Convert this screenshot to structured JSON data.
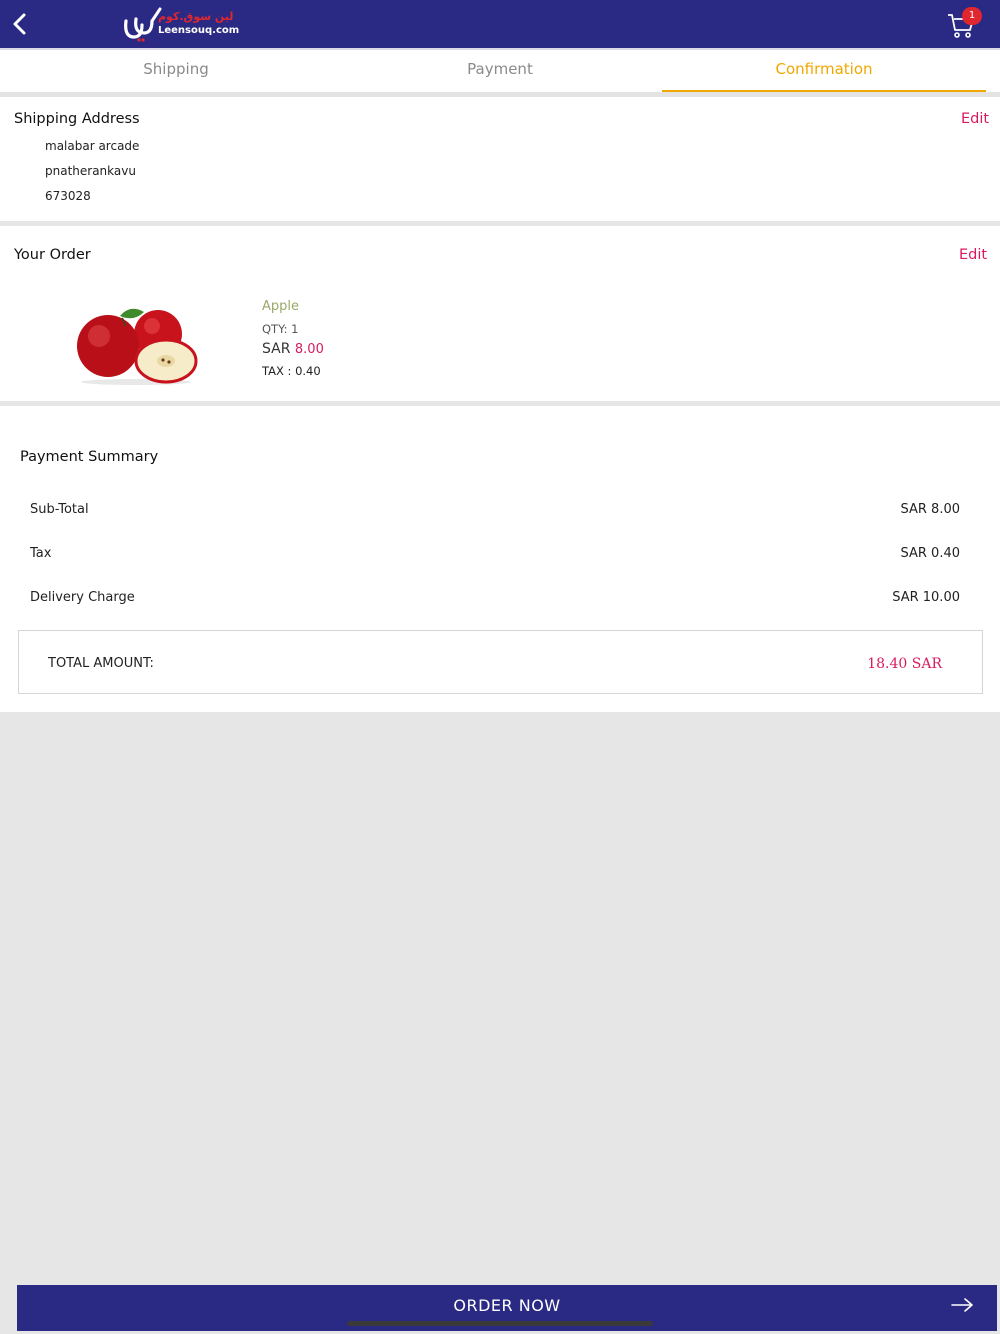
{
  "header": {
    "logo_text_arabic": "لين سوق.كوم",
    "logo_text": "Leensouq.com",
    "cart_count": "1"
  },
  "tabs": [
    {
      "label": "Shipping",
      "active": false
    },
    {
      "label": "Payment",
      "active": false
    },
    {
      "label": "Confirmation",
      "active": true
    }
  ],
  "shipping_address": {
    "title": "Shipping Address",
    "edit_label": "Edit",
    "lines": [
      "malabar arcade",
      "pnatherankavu",
      "673028"
    ]
  },
  "order": {
    "title": "Your Order",
    "edit_label": "Edit",
    "item": {
      "name": "Apple",
      "qty": "QTY: 1",
      "currency": "SAR",
      "price": "8.00",
      "tax": "TAX : 0.40"
    }
  },
  "payment_summary": {
    "title": "Payment Summary",
    "rows": [
      {
        "label": "Sub-Total",
        "value": "SAR 8.00"
      },
      {
        "label": "Tax",
        "value": "SAR 0.40"
      },
      {
        "label": "Delivery Charge",
        "value": "SAR 10.00"
      }
    ],
    "total_label": "TOTAL AMOUNT:",
    "total_value": "18.40 SAR"
  },
  "footer": {
    "order_button_label": "ORDER NOW"
  },
  "colors": {
    "brand_navy": "#2a2a84",
    "accent_orange": "#f0a800",
    "accent_pink": "#d81b60",
    "badge_red": "#e0262f"
  }
}
